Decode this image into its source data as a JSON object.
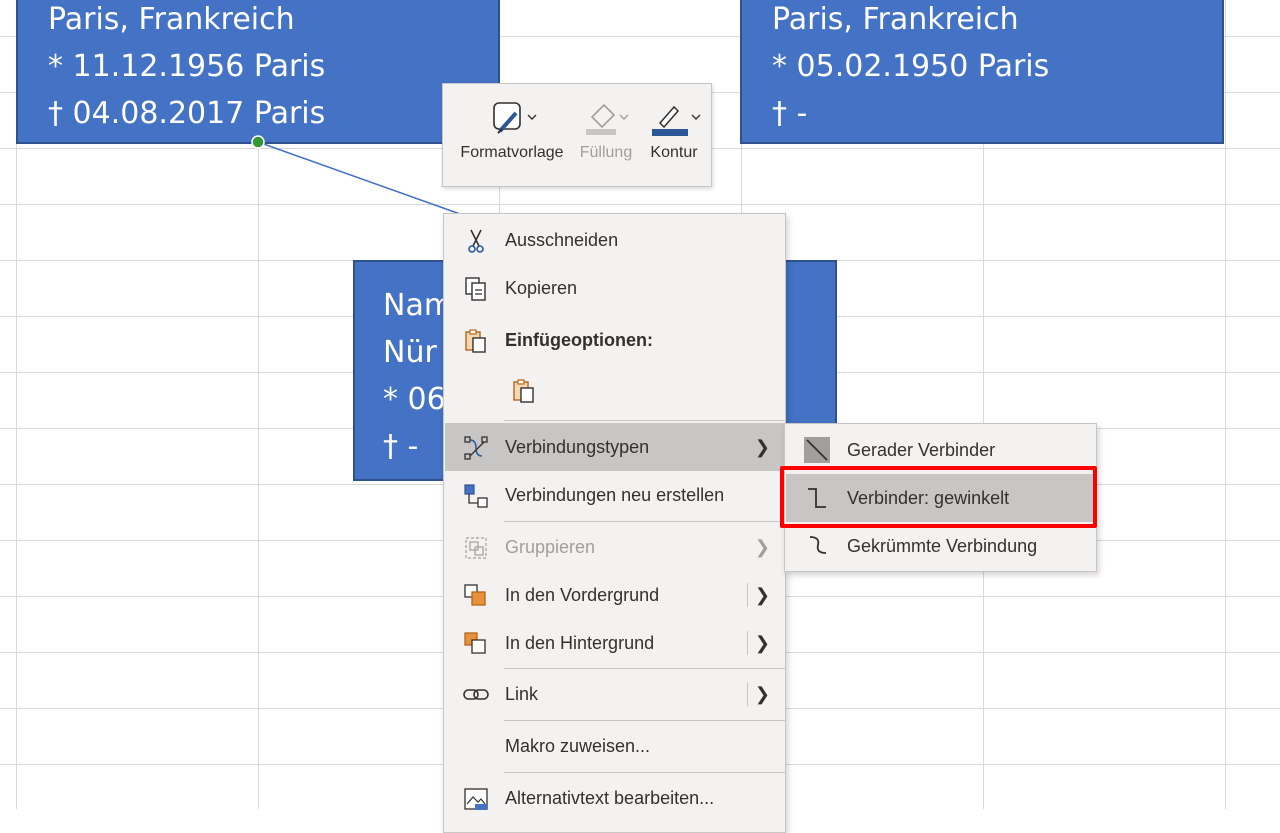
{
  "shapes": [
    {
      "lines": [
        "Paris, Frankreich",
        "* 11.12.1956 Paris",
        "† 04.08.2017 Paris"
      ]
    },
    {
      "lines": [
        "Paris, Frankreich",
        "* 05.02.1950 Paris",
        "† -"
      ]
    },
    {
      "lines": [
        "Nam",
        "Nür",
        "* 06",
        "† -"
      ]
    }
  ],
  "mini_toolbar": {
    "style_label": "Formatvorlage",
    "fill_label": "Füllung",
    "outline_label": "Kontur"
  },
  "context_menu": {
    "cut": "Ausschneiden",
    "copy": "Kopieren",
    "paste_options": "Einfügeoptionen:",
    "connector_types": "Verbindungstypen",
    "reroute": "Verbindungen neu erstellen",
    "group": "Gruppieren",
    "bring_front": "In den Vordergrund",
    "send_back": "In den Hintergrund",
    "link": "Link",
    "assign_macro": "Makro zuweisen...",
    "alt_text": "Alternativtext bearbeiten..."
  },
  "submenu": {
    "straight": "Gerader Verbinder",
    "elbow": "Verbinder: gewinkelt",
    "curved": "Gekrümmte Verbindung"
  },
  "icons": {
    "cut": "scissors-icon",
    "copy": "copy-icon",
    "paste": "paste-icon",
    "connector": "connector-types-icon",
    "reroute": "reroute-icon",
    "group": "group-icon",
    "front": "bring-front-icon",
    "back": "send-back-icon",
    "link": "link-icon",
    "alt": "alt-text-icon"
  },
  "colors": {
    "shape_fill": "#4472c4",
    "menu_bg": "#f3f2f1",
    "hover": "#c8c6c4",
    "highlight": "#ff0000",
    "connector_handle": "#339933"
  }
}
